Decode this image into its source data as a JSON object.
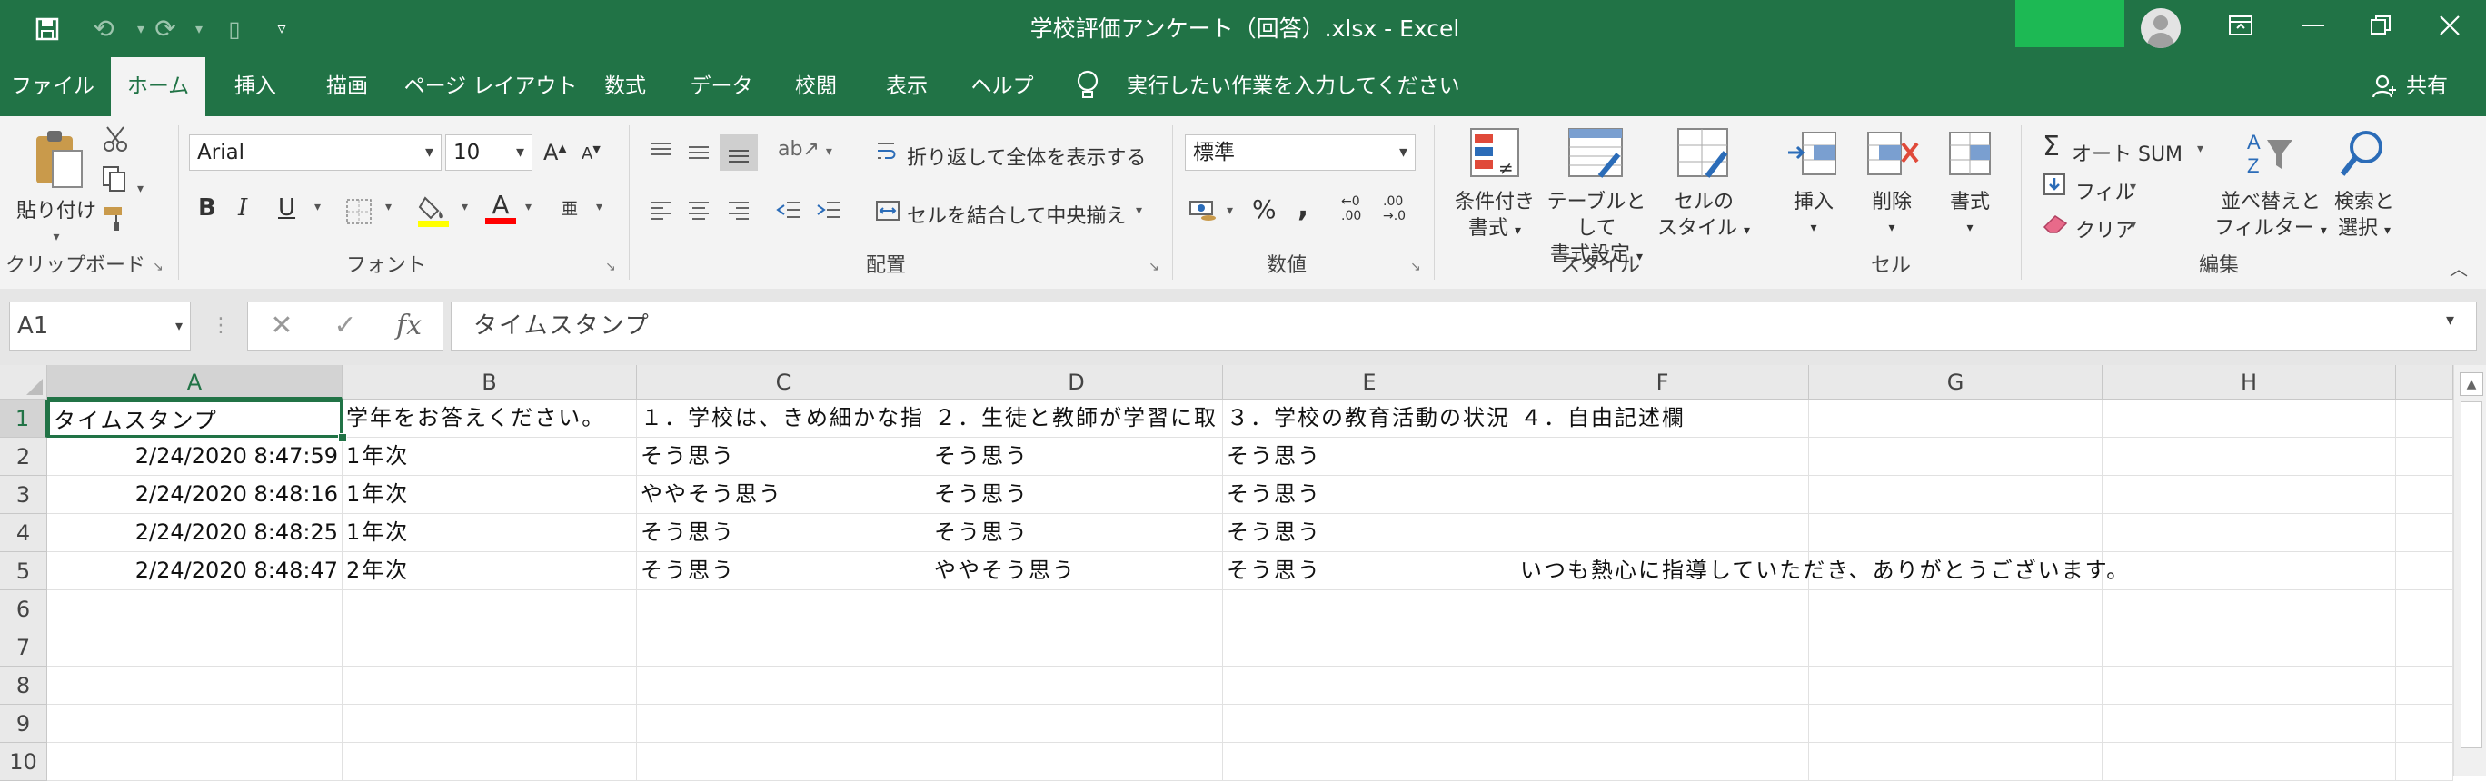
{
  "window": {
    "title": "学校評価アンケート（回答）.xlsx  -  Excel"
  },
  "qat": {
    "save_icon": "save-icon",
    "undo_icon": "undo-icon",
    "redo_icon": "redo-icon",
    "customize_icon": "chevron-down-icon"
  },
  "tabs": [
    {
      "label": "ファイル"
    },
    {
      "label": "ホーム"
    },
    {
      "label": "挿入"
    },
    {
      "label": "描画"
    },
    {
      "label": "ページ レイアウト"
    },
    {
      "label": "数式"
    },
    {
      "label": "データ"
    },
    {
      "label": "校閲"
    },
    {
      "label": "表示"
    },
    {
      "label": "ヘルプ"
    }
  ],
  "tell_me": "実行したい作業を入力してください",
  "share": "共有",
  "ribbon": {
    "clipboard": {
      "label": "クリップボード",
      "paste": "貼り付け"
    },
    "font": {
      "label": "フォント",
      "name": "Arial",
      "size": "10",
      "bold": "B",
      "italic": "I",
      "underline": "U",
      "font_color_letter": "A",
      "highlight_color": "#ffff00",
      "font_color": "#ff0000",
      "phonetic": "亜"
    },
    "alignment": {
      "label": "配置",
      "wrap_text": "折り返して全体を表示する",
      "merge_center": "セルを結合して中央揃え"
    },
    "number": {
      "label": "数値",
      "format": "標準",
      "percent": "%",
      "comma": ","
    },
    "styles": {
      "label": "スタイル",
      "conditional_1": "条件付き",
      "conditional_2": "書式",
      "table_1": "テーブルとして",
      "table_2": "書式設定",
      "cell_1": "セルの",
      "cell_2": "スタイル"
    },
    "cells": {
      "label": "セル",
      "insert": "挿入",
      "delete": "削除",
      "format": "書式"
    },
    "editing": {
      "label": "編集",
      "autosum": "オート SUM",
      "fill": "フィル",
      "clear": "クリア",
      "sort_1": "並べ替えと",
      "sort_2": "フィルター",
      "find_1": "検索と",
      "find_2": "選択"
    }
  },
  "formula_bar": {
    "name_box": "A1",
    "fx": "fx",
    "content": "タイムスタンプ"
  },
  "columns": [
    "A",
    "B",
    "C",
    "D",
    "E",
    "F",
    "G",
    "H"
  ],
  "rows": [
    "1",
    "2",
    "3",
    "4",
    "5",
    "6",
    "7",
    "8",
    "9",
    "10"
  ],
  "cells": [
    [
      "タイムスタンプ",
      "学年をお答えください。",
      "１．学校は、きめ細かな指",
      "２．生徒と教師が学習に取",
      "３．学校の教育活動の状況",
      "４．自由記述欄",
      "",
      ""
    ],
    [
      "2/24/2020 8:47:59",
      "1年次",
      "そう思う",
      "そう思う",
      "そう思う",
      "",
      "",
      ""
    ],
    [
      "2/24/2020 8:48:16",
      "1年次",
      "ややそう思う",
      "そう思う",
      "そう思う",
      "",
      "",
      ""
    ],
    [
      "2/24/2020 8:48:25",
      "1年次",
      "そう思う",
      "そう思う",
      "そう思う",
      "",
      "",
      ""
    ],
    [
      "2/24/2020 8:48:47",
      "2年次",
      "そう思う",
      "ややそう思う",
      "そう思う",
      "いつも熱心に指導していただき、ありがとうございます。",
      "",
      ""
    ]
  ],
  "colors": {
    "excel_green": "#217346",
    "title_badge": "#1db954"
  }
}
